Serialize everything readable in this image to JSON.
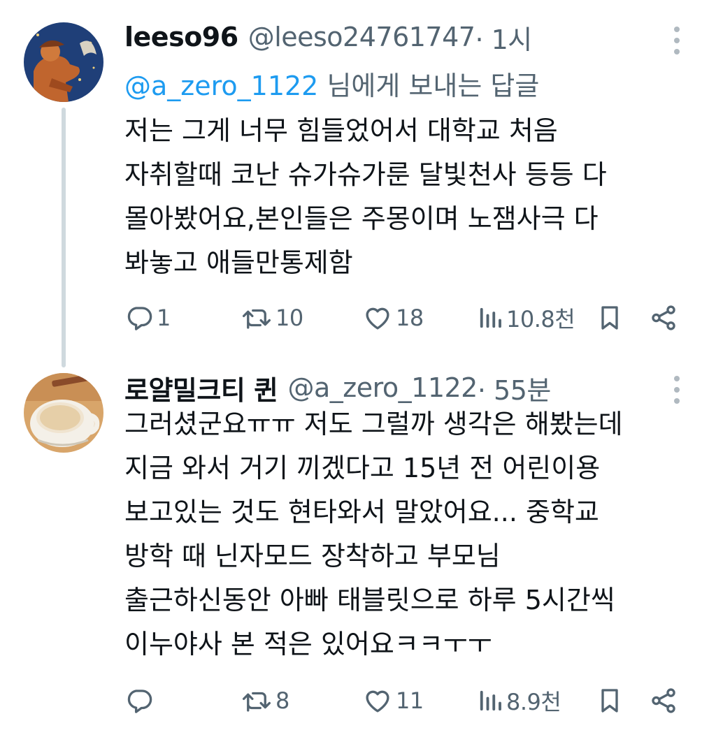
{
  "tweets": [
    {
      "display_name": "leeso96",
      "handle": "@leeso24761747",
      "time": " · 1시",
      "replying_mention": "@a_zero_1122",
      "replying_suffix": " 님에게 보내는 답글",
      "body_lines": [
        "저는 그게 너무 힘들었어서 대학교 처음",
        "자취할때 코난 슈가슈가룬 달빛천사 등등 다",
        "몰아봤어요,본인들은 주몽이며 노잼사극 다",
        "봐놓고 애들만통제함"
      ],
      "stats": {
        "replies": "1",
        "retweets": "10",
        "likes": "18",
        "views": "10.8천"
      }
    },
    {
      "display_name": "로얄밀크티 퀸",
      "handle": "@a_zero_1122",
      "time": " · 55분",
      "body_lines": [
        "그러셨군요ㅠㅠ 저도 그럴까 생각은 해봤는데",
        "지금 와서 거기 끼겠다고 15년 전 어린이용",
        "보고있는 것도 현타와서 말았어요... 중학교",
        "방학 때 닌자모드 장착하고 부모님",
        "출근하신동안 아빠 태블릿으로 하루 5시간씩",
        "이누야사 본 적은 있어요ㅋㅋㅜㅜ"
      ],
      "stats": {
        "replies": "",
        "retweets": "8",
        "likes": "11",
        "views": "8.9천"
      }
    }
  ],
  "icons": [
    "reply-icon",
    "retweet-icon",
    "like-icon",
    "views-icon",
    "bookmark-icon",
    "share-icon",
    "more-icon"
  ],
  "colors": {
    "text": "#0f1419",
    "muted": "#536471",
    "link": "#1d9bf0",
    "thread_line": "#cfd9de"
  }
}
